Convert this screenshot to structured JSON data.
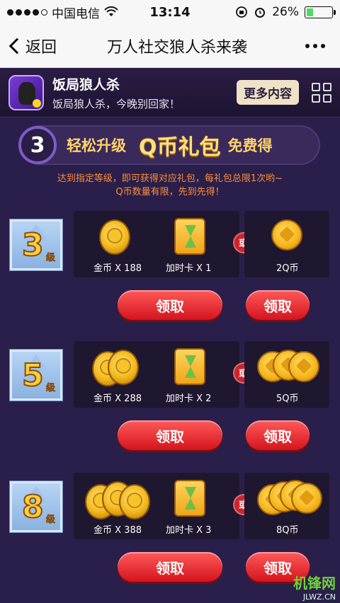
{
  "status_bar": {
    "carrier": "中国电信",
    "time": "13:14",
    "battery_percent": "26%",
    "battery_level": 0.26,
    "icons": [
      "signal-dots",
      "wifi-icon",
      "orientation-lock-icon",
      "alarm-icon",
      "battery-icon"
    ]
  },
  "nav": {
    "back_label": "返回",
    "title": "万人社交狼人杀来袭"
  },
  "app": {
    "name": "饭局狼人杀",
    "slogan": "饭局狼人杀，今晚别回家！",
    "more_label": "更多内容"
  },
  "banner": {
    "step": "3",
    "text_a": "轻松升级",
    "text_b": "Q币礼包",
    "text_c": "免费得"
  },
  "notice": {
    "line1": "达到指定等级，即可获得对应礼包，每礼包总限1次哟~",
    "line2": "Q币数量有限，先到先得！"
  },
  "tiers": [
    {
      "level": "3",
      "level_unit": "级",
      "coin_label": "金币 X 188",
      "card_label": "加时卡 X 1",
      "or_label": "或",
      "q_label": "2Q币",
      "claim_label": "领取",
      "claim_alt_label": "领取"
    },
    {
      "level": "5",
      "level_unit": "级",
      "coin_label": "金币 X 288",
      "card_label": "加时卡 X 2",
      "or_label": "或",
      "q_label": "5Q币",
      "claim_label": "领取",
      "claim_alt_label": "领取"
    },
    {
      "level": "8",
      "level_unit": "级",
      "coin_label": "金币 X 388",
      "card_label": "加时卡 X 3",
      "or_label": "或",
      "q_label": "8Q币",
      "claim_label": "领取",
      "claim_alt_label": "领取"
    }
  ],
  "watermark": {
    "top": "机锋网",
    "bottom": "JLWZ.CN"
  },
  "colors": {
    "background": "#2a1f4a",
    "button": "#d4141e",
    "accent_gold": "#ffcf3a",
    "notice": "#ff8d3a"
  }
}
